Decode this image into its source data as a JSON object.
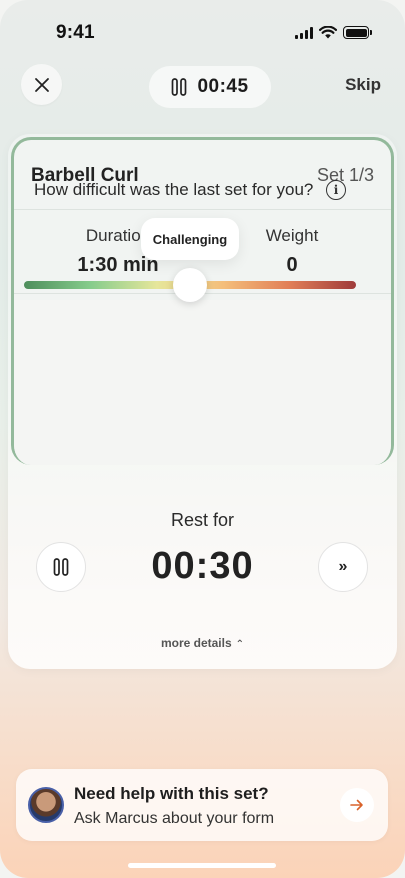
{
  "status_bar": {
    "time": "9:41"
  },
  "top_nav": {
    "workout_timer": "00:45",
    "skip_label": "Skip"
  },
  "exercise": {
    "name": "Barbell Curl",
    "set_label": "Set 1/3",
    "stats": [
      {
        "label": "Duration",
        "value": "1:30 min"
      },
      {
        "label": "Weight",
        "value": "0"
      }
    ]
  },
  "difficulty": {
    "question": "How difficult was the last set for you?",
    "selected_label": "Challenging",
    "slider_level": 0.5,
    "gradient_colors": [
      "#4e8e5c",
      "#86cc8c",
      "#e6e69a",
      "#f4be7a",
      "#e17e57",
      "#9e3b3b"
    ]
  },
  "rest": {
    "label": "Rest for",
    "time": "00:30",
    "skip_symbol": "»"
  },
  "more_details_label": "more details",
  "help": {
    "title": "Need help with this set?",
    "subtitle": "Ask Marcus about your form"
  },
  "icons": {
    "close": "close-icon",
    "pause": "pause-icon",
    "info": "info-icon",
    "forward": "fast-forward-icon",
    "arrow": "arrow-right-icon",
    "chevron": "chevron-up-icon"
  }
}
